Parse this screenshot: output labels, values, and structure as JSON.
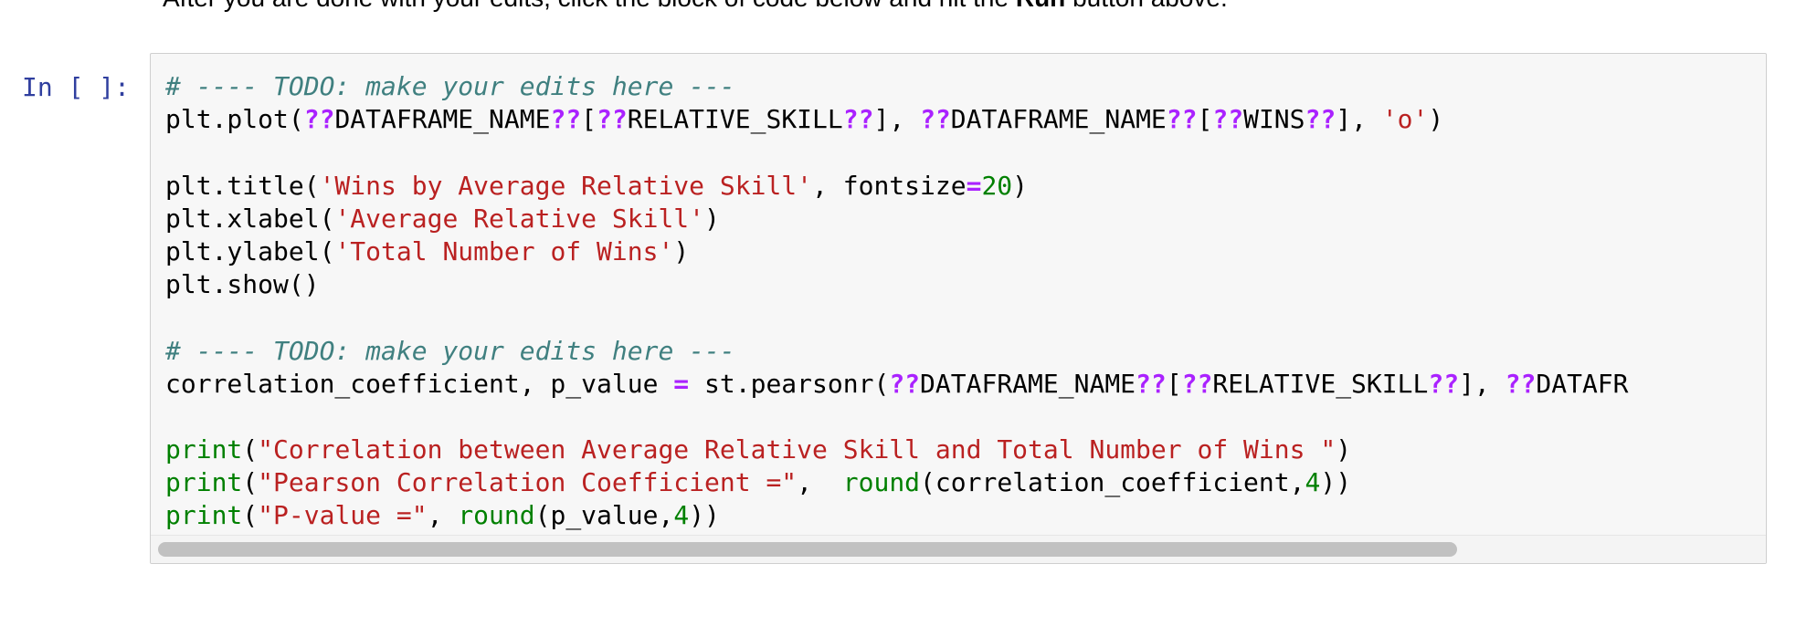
{
  "instruction": {
    "text_before": "After you are done with your edits, click the block of code below and hit the ",
    "run_word": "Run",
    "text_after": " button above."
  },
  "cell": {
    "prompt": "In [ ]:",
    "code_lines": [
      [
        {
          "t": "# ---- TODO: make your edits here ---",
          "c": "cm"
        }
      ],
      [
        {
          "t": "plt.plot(",
          "c": ""
        },
        {
          "t": "??",
          "c": "o"
        },
        {
          "t": "DATAFRAME_NAME",
          "c": ""
        },
        {
          "t": "??",
          "c": "o"
        },
        {
          "t": "[",
          "c": ""
        },
        {
          "t": "??",
          "c": "o"
        },
        {
          "t": "RELATIVE_SKILL",
          "c": ""
        },
        {
          "t": "??",
          "c": "o"
        },
        {
          "t": "], ",
          "c": ""
        },
        {
          "t": "??",
          "c": "o"
        },
        {
          "t": "DATAFRAME_NAME",
          "c": ""
        },
        {
          "t": "??",
          "c": "o"
        },
        {
          "t": "[",
          "c": ""
        },
        {
          "t": "??",
          "c": "o"
        },
        {
          "t": "WINS",
          "c": ""
        },
        {
          "t": "??",
          "c": "o"
        },
        {
          "t": "], ",
          "c": ""
        },
        {
          "t": "'o'",
          "c": "s"
        },
        {
          "t": ")",
          "c": ""
        }
      ],
      [],
      [
        {
          "t": "plt.title(",
          "c": ""
        },
        {
          "t": "'Wins by Average Relative Skill'",
          "c": "s"
        },
        {
          "t": ", fontsize",
          "c": ""
        },
        {
          "t": "=",
          "c": "o"
        },
        {
          "t": "20",
          "c": "mi"
        },
        {
          "t": ")",
          "c": ""
        }
      ],
      [
        {
          "t": "plt.xlabel(",
          "c": ""
        },
        {
          "t": "'Average Relative Skill'",
          "c": "s"
        },
        {
          "t": ")",
          "c": ""
        }
      ],
      [
        {
          "t": "plt.ylabel(",
          "c": ""
        },
        {
          "t": "'Total Number of Wins'",
          "c": "s"
        },
        {
          "t": ")",
          "c": ""
        }
      ],
      [
        {
          "t": "plt.show()",
          "c": ""
        }
      ],
      [],
      [
        {
          "t": "# ---- TODO: make your edits here ---",
          "c": "cm"
        }
      ],
      [
        {
          "t": "correlation_coefficient, p_value ",
          "c": ""
        },
        {
          "t": "=",
          "c": "o"
        },
        {
          "t": " st.pearsonr(",
          "c": ""
        },
        {
          "t": "??",
          "c": "o"
        },
        {
          "t": "DATAFRAME_NAME",
          "c": ""
        },
        {
          "t": "??",
          "c": "o"
        },
        {
          "t": "[",
          "c": ""
        },
        {
          "t": "??",
          "c": "o"
        },
        {
          "t": "RELATIVE_SKILL",
          "c": ""
        },
        {
          "t": "??",
          "c": "o"
        },
        {
          "t": "], ",
          "c": ""
        },
        {
          "t": "??",
          "c": "o"
        },
        {
          "t": "DATAFR",
          "c": ""
        }
      ],
      [],
      [
        {
          "t": "print",
          "c": "nb"
        },
        {
          "t": "(",
          "c": ""
        },
        {
          "t": "\"Correlation between Average Relative Skill and Total Number of Wins \"",
          "c": "s"
        },
        {
          "t": ")",
          "c": ""
        }
      ],
      [
        {
          "t": "print",
          "c": "nb"
        },
        {
          "t": "(",
          "c": ""
        },
        {
          "t": "\"Pearson Correlation Coefficient =\"",
          "c": "s"
        },
        {
          "t": ",  ",
          "c": ""
        },
        {
          "t": "round",
          "c": "nb"
        },
        {
          "t": "(correlation_coefficient,",
          "c": ""
        },
        {
          "t": "4",
          "c": "mi"
        },
        {
          "t": "))",
          "c": ""
        }
      ],
      [
        {
          "t": "print",
          "c": "nb"
        },
        {
          "t": "(",
          "c": ""
        },
        {
          "t": "\"P-value =\"",
          "c": "s"
        },
        {
          "t": ", ",
          "c": ""
        },
        {
          "t": "round",
          "c": "nb"
        },
        {
          "t": "(p_value,",
          "c": ""
        },
        {
          "t": "4",
          "c": "mi"
        },
        {
          "t": "))",
          "c": ""
        }
      ]
    ]
  },
  "colors": {
    "comment": "#408080",
    "string": "#ba2121",
    "operator": "#aa22ff",
    "number": "#008000",
    "builtin": "#008000",
    "prompt": "#303f9f",
    "cell_background": "#f7f7f7",
    "cell_border": "#cfcfcf"
  }
}
